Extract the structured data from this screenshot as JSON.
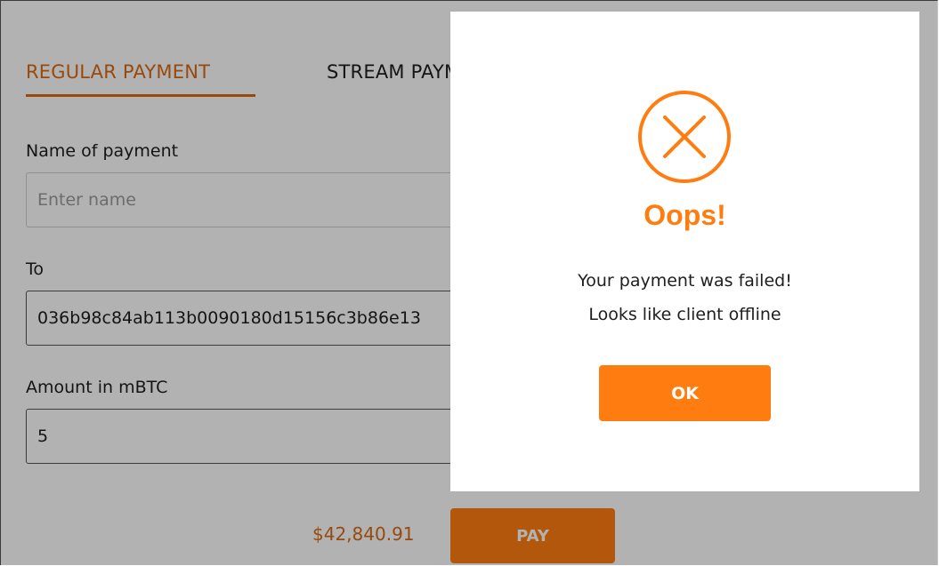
{
  "tabs": {
    "regular": "REGULAR PAYMENT",
    "stream": "STREAM PAYMENT"
  },
  "form": {
    "name_label": "Name of payment",
    "name_placeholder": "Enter name",
    "to_label": "To",
    "to_value": "036b98c84ab113b0090180d15156c3b86e13",
    "amount_label": "Amount in mBTC",
    "amount_value": "5"
  },
  "footer": {
    "price": "$42,840.91",
    "pay_label": "PAY"
  },
  "modal": {
    "icon": "circle-x-icon",
    "title": "Oops!",
    "message_line1": "Your payment was failed!",
    "message_line2": "Looks like client offline",
    "ok_label": "OK"
  },
  "colors": {
    "accent": "#ff7d10",
    "accent_text": "#d96a14",
    "overlay": "rgba(0,0,0,0.30)"
  }
}
